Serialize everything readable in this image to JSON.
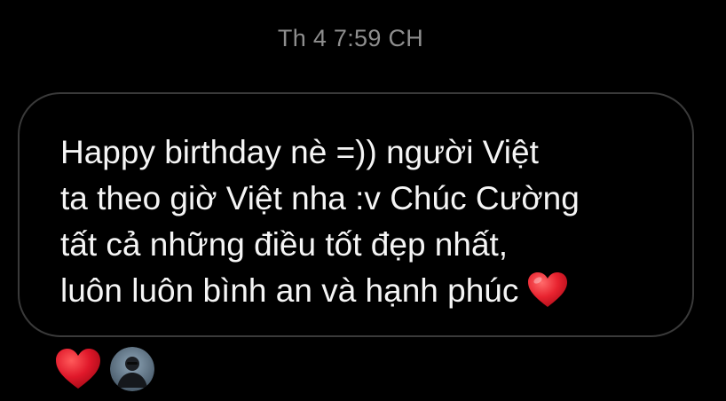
{
  "thread": {
    "timestamp": "Th 4 7:59 CH"
  },
  "message": {
    "lines": [
      "Happy birthday nè =)) người Việt",
      "ta theo giờ Việt nha :v Chúc Cường",
      "tất cả những điều tốt đẹp nhất,",
      "luôn luôn bình an và hạnh phúc"
    ],
    "trailing_emoji": "red-heart-icon",
    "bubble_border_color": "#3a3a3a",
    "text_color": "#f5f5f5"
  },
  "reactions": {
    "emoji": "red-heart-icon",
    "emoji_color": "#e0182a",
    "reactor_avatar": "avatar"
  },
  "colors": {
    "background": "#000000",
    "timestamp": "#8e8e8e"
  }
}
